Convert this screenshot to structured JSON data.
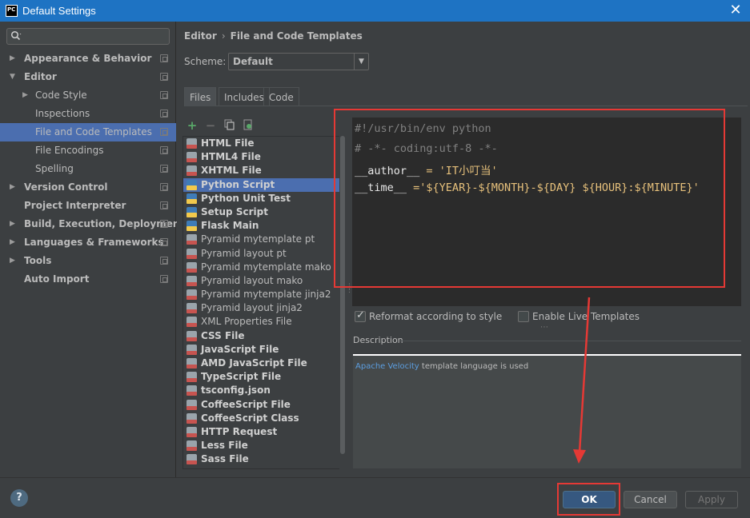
{
  "window": {
    "title": "Default Settings",
    "app_icon_text": "PC"
  },
  "search": {
    "value": "",
    "placeholder": ""
  },
  "sidebar": {
    "items": [
      {
        "label": "Appearance & Behavior",
        "arrow": "▶",
        "bold": true,
        "depth": 0
      },
      {
        "label": "Editor",
        "arrow": "▼",
        "bold": true,
        "depth": 0
      },
      {
        "label": "Code Style",
        "arrow": "▶",
        "bold": false,
        "depth": 1
      },
      {
        "label": "Inspections",
        "arrow": "",
        "bold": false,
        "depth": 1
      },
      {
        "label": "File and Code Templates",
        "arrow": "",
        "bold": false,
        "depth": 1,
        "selected": true
      },
      {
        "label": "File Encodings",
        "arrow": "",
        "bold": false,
        "depth": 1
      },
      {
        "label": "Spelling",
        "arrow": "",
        "bold": false,
        "depth": 1
      },
      {
        "label": "Version Control",
        "arrow": "▶",
        "bold": true,
        "depth": 0
      },
      {
        "label": "Project Interpreter",
        "arrow": "",
        "bold": true,
        "depth": 0
      },
      {
        "label": "Build, Execution, Deployment",
        "arrow": "▶",
        "bold": true,
        "depth": 0
      },
      {
        "label": "Languages & Frameworks",
        "arrow": "▶",
        "bold": true,
        "depth": 0
      },
      {
        "label": "Tools",
        "arrow": "▶",
        "bold": true,
        "depth": 0
      },
      {
        "label": "Auto Import",
        "arrow": "",
        "bold": true,
        "depth": 0
      }
    ]
  },
  "breadcrumb": {
    "parent": "Editor",
    "separator": "›",
    "current": "File and Code Templates"
  },
  "scheme": {
    "label": "Scheme:",
    "value": "Default",
    "dropdown_glyph": "▼"
  },
  "tabs": [
    {
      "label": "Files",
      "active": true
    },
    {
      "label": "Includes",
      "active": false
    },
    {
      "label": "Code",
      "active": false
    }
  ],
  "toolbar": {
    "add": "+",
    "remove": "−"
  },
  "files": [
    {
      "name": "HTML File",
      "bold": true,
      "icon": "html-file-icon"
    },
    {
      "name": "HTML4 File",
      "bold": true,
      "icon": "html-file-icon"
    },
    {
      "name": "XHTML File",
      "bold": true,
      "icon": "xhtml-file-icon"
    },
    {
      "name": "Python Script",
      "bold": true,
      "icon": "python-icon",
      "selected": true
    },
    {
      "name": "Python Unit Test",
      "bold": true,
      "icon": "python-icon"
    },
    {
      "name": "Setup Script",
      "bold": true,
      "icon": "python-icon"
    },
    {
      "name": "Flask Main",
      "bold": true,
      "icon": "python-icon"
    },
    {
      "name": "Pyramid mytemplate pt",
      "bold": false,
      "icon": "template-file-icon"
    },
    {
      "name": "Pyramid layout pt",
      "bold": false,
      "icon": "template-file-icon"
    },
    {
      "name": "Pyramid mytemplate mako",
      "bold": false,
      "icon": "template-file-icon"
    },
    {
      "name": "Pyramid layout mako",
      "bold": false,
      "icon": "template-file-icon"
    },
    {
      "name": "Pyramid mytemplate jinja2",
      "bold": false,
      "icon": "template-file-icon"
    },
    {
      "name": "Pyramid layout jinja2",
      "bold": false,
      "icon": "template-file-icon"
    },
    {
      "name": "XML Properties File",
      "bold": false,
      "icon": "xml-file-icon"
    },
    {
      "name": "CSS File",
      "bold": true,
      "icon": "css-file-icon"
    },
    {
      "name": "JavaScript File",
      "bold": true,
      "icon": "js-file-icon"
    },
    {
      "name": "AMD JavaScript File",
      "bold": true,
      "icon": "js-file-icon"
    },
    {
      "name": "TypeScript File",
      "bold": true,
      "icon": "ts-file-icon"
    },
    {
      "name": "tsconfig.json",
      "bold": true,
      "icon": "json-file-icon"
    },
    {
      "name": "CoffeeScript File",
      "bold": true,
      "icon": "coffee-file-icon"
    },
    {
      "name": "CoffeeScript Class",
      "bold": true,
      "icon": "coffee-file-icon"
    },
    {
      "name": "HTTP Request",
      "bold": true,
      "icon": "http-file-icon"
    },
    {
      "name": "Less File",
      "bold": true,
      "icon": "less-file-icon"
    },
    {
      "name": "Sass File",
      "bold": true,
      "icon": "sass-file-icon"
    }
  ],
  "editor": {
    "line1": "#!/usr/bin/env python",
    "line2": "# -*- coding:utf-8 -*-",
    "line3_a": "__author__",
    "line3_b": " = ",
    "line3_c": "'IT小叮当'",
    "line4_a": "__time__",
    "line4_b": " =",
    "line4_c": "'${YEAR}-${MONTH}-${DAY} ${HOUR}:${MINUTE}'"
  },
  "options": {
    "reformat": {
      "label": "Reformat according to style",
      "checked": true
    },
    "live_templates": {
      "label": "Enable Live Templates",
      "checked": false
    }
  },
  "description": {
    "label": "Description",
    "link": "Apache Velocity",
    "text": " template language is used"
  },
  "buttons": {
    "help": "?",
    "ok": "OK",
    "cancel": "Cancel",
    "apply": "Apply"
  },
  "colors": {
    "accent": "#4b6eaf",
    "titlebar": "#1e73c3",
    "annotation": "#e53935"
  }
}
